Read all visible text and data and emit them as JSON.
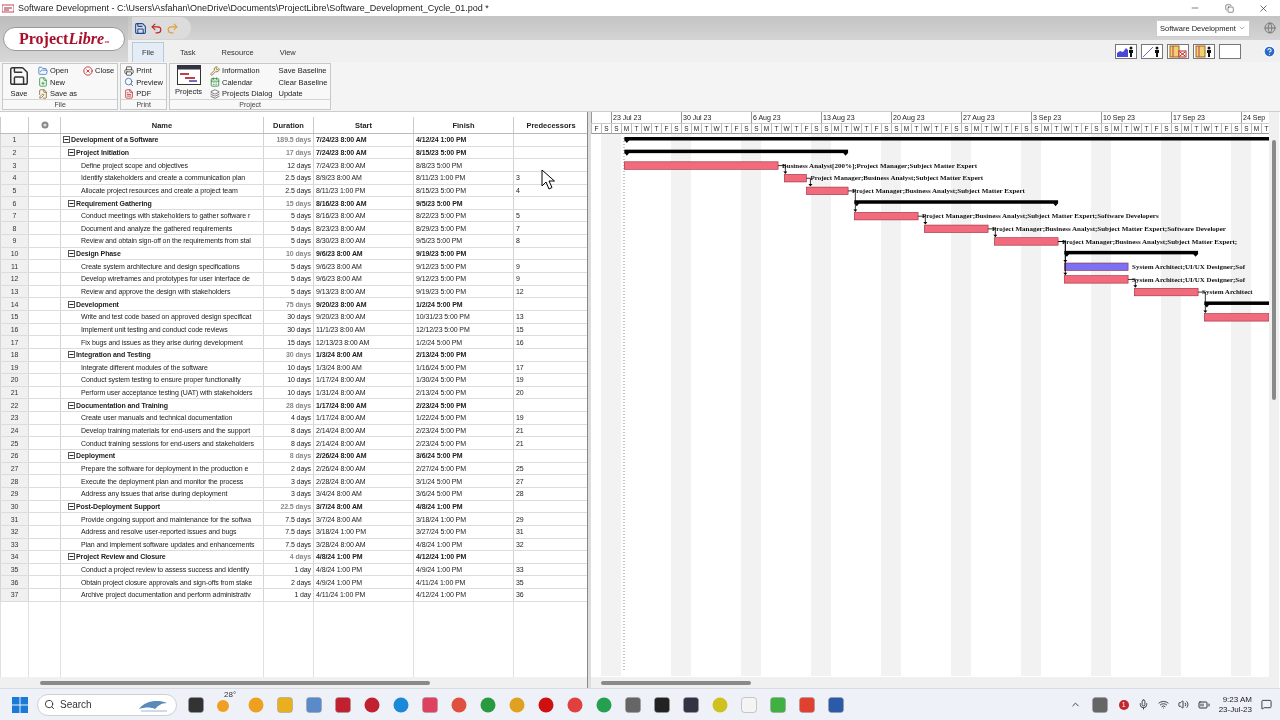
{
  "window": {
    "title": "Software Development  - C:\\Users\\Asfahan\\OneDrive\\Documents\\ProjectLibre\\Software_Development_Cycle_01.pod *"
  },
  "logo": {
    "text": "Project",
    "suffix": "Libre",
    "trademark": "™"
  },
  "tabs": [
    {
      "label": "File",
      "selected": true
    },
    {
      "label": "Task",
      "selected": false
    },
    {
      "label": "Resource",
      "selected": false
    },
    {
      "label": "View",
      "selected": false
    }
  ],
  "project_switcher": {
    "value": "Software Development"
  },
  "ribbon": {
    "groups": [
      {
        "title": "File",
        "items": [
          {
            "label": "Save",
            "kind": "large"
          },
          {
            "label": "Open",
            "kind": "small"
          },
          {
            "label": "New",
            "kind": "small"
          },
          {
            "label": "Save as",
            "kind": "small"
          },
          {
            "label": "Close",
            "kind": "small"
          }
        ]
      },
      {
        "title": "Print",
        "items": [
          {
            "label": "Print",
            "kind": "small"
          },
          {
            "label": "Preview",
            "kind": "small"
          },
          {
            "label": "PDF",
            "kind": "small"
          }
        ]
      },
      {
        "title": "Project",
        "items": [
          {
            "label": "Projects",
            "kind": "large"
          },
          {
            "label": "Information",
            "kind": "small"
          },
          {
            "label": "Calendar",
            "kind": "small"
          },
          {
            "label": "Projects Dialog",
            "kind": "small"
          },
          {
            "label": "Save Baseline",
            "kind": "text"
          },
          {
            "label": "Clear Baseline",
            "kind": "text"
          },
          {
            "label": "Update",
            "kind": "text"
          }
        ]
      }
    ]
  },
  "table": {
    "columns": [
      "Name",
      "Duration",
      "Start",
      "Finish",
      "Predecessors"
    ],
    "rows": [
      {
        "id": "1",
        "kind": "summary",
        "expanded": true,
        "name": "Development of a Software",
        "duration": "189.5 days",
        "start": "7/24/23 8:00 AM",
        "finish": "4/12/24 1:00 PM",
        "children": [
          {
            "id": "2",
            "kind": "summary",
            "expanded": true,
            "name": "Project Initiation",
            "duration": "17 days",
            "start": "7/24/23 8:00 AM",
            "finish": "8/15/23 5:00 PM",
            "children": [
              {
                "id": "3",
                "kind": "task",
                "name": "Define project scope and objectives",
                "duration": "12 days",
                "start": "7/24/23 8:00 AM",
                "finish": "8/8/23 5:00 PM",
                "color": "#f26b7c",
                "resources": "Business Analyst[200%];Project Manager;Subject Matter Expert"
              },
              {
                "id": "4",
                "kind": "task",
                "name": "Identify stakeholders and create a communication plan",
                "duration": "2.5 days",
                "start": "8/9/23 8:00 AM",
                "finish": "8/11/23 1:00 PM",
                "predecessors": "3",
                "color": "#f26b7c",
                "resources": "Project Manager;Business Analyst;Subject Matter Expert"
              },
              {
                "id": "5",
                "kind": "task",
                "name": "Allocate project resources and create a project team",
                "duration": "2.5 days",
                "start": "8/11/23 1:00 PM",
                "finish": "8/15/23 5:00 PM",
                "predecessors": "4",
                "color": "#f26b7c",
                "resources": "Project Manager;Business Analyst;Subject Matter Expert"
              }
            ]
          },
          {
            "id": "6",
            "kind": "summary",
            "expanded": true,
            "name": "Requirement Gathering",
            "duration": "15 days",
            "start": "8/16/23 8:00 AM",
            "finish": "9/5/23 5:00 PM",
            "children": [
              {
                "id": "7",
                "kind": "task",
                "name": "Conduct meetings with stakeholders to gather software r",
                "duration": "5 days",
                "start": "8/16/23 8:00 AM",
                "finish": "8/22/23 5:00 PM",
                "predecessors": "5",
                "color": "#f26b7c",
                "resources": "Project Manager;Business Analyst;Subject Matter Expert;Software Developers"
              },
              {
                "id": "8",
                "kind": "task",
                "name": "Document and analyze the gathered requirements",
                "duration": "5 days",
                "start": "8/23/23 8:00 AM",
                "finish": "8/29/23 5:00 PM",
                "predecessors": "7",
                "color": "#f26b7c",
                "resources": "Project Manager;Business Analyst;Subject Matter Expert;Software Developer"
              },
              {
                "id": "9",
                "kind": "task",
                "name": "Review and obtain sign-off on the requirements from stal",
                "duration": "5 days",
                "start": "8/30/23 8:00 AM",
                "finish": "9/5/23 5:00 PM",
                "predecessors": "8",
                "color": "#f26b7c",
                "resources": "Project Manager;Business Analyst;Subject Matter Expert;"
              }
            ]
          },
          {
            "id": "10",
            "kind": "summary",
            "expanded": true,
            "name": "Design Phase",
            "duration": "10 days",
            "start": "9/6/23 8:00 AM",
            "finish": "9/19/23 5:00 PM",
            "children": [
              {
                "id": "11",
                "kind": "task",
                "name": "Create system architecture and design specifications",
                "duration": "5 days",
                "start": "9/6/23 8:00 AM",
                "finish": "9/12/23 5:00 PM",
                "predecessors": "9",
                "color": "#7a72f2",
                "resources": "System Architect;UI/UX Designer;Sof"
              },
              {
                "id": "12",
                "kind": "task",
                "name": "Develop wireframes and prototypes for user interface de",
                "duration": "5 days",
                "start": "9/6/23 8:00 AM",
                "finish": "9/12/23 5:00 PM",
                "predecessors": "9",
                "color": "#f26b7c",
                "resources": "System Architect;UI/UX Designer;Sof"
              },
              {
                "id": "13",
                "kind": "task",
                "name": "Review and approve the design with stakeholders",
                "duration": "5 days",
                "start": "9/13/23 8:00 AM",
                "finish": "9/19/23 5:00 PM",
                "predecessors": "12",
                "color": "#f26b7c",
                "resources": "System Architect"
              }
            ]
          },
          {
            "id": "14",
            "kind": "summary",
            "expanded": true,
            "name": "Development",
            "duration": "75 days",
            "start": "9/20/23 8:00 AM",
            "finish": "1/2/24 5:00 PM",
            "children": [
              {
                "id": "15",
                "kind": "task",
                "name": "Write and test code based on approved design specificat",
                "duration": "30 days",
                "start": "9/20/23 8:00 AM",
                "finish": "10/31/23 5:00 PM",
                "predecessors": "13",
                "color": "#f26b7c"
              },
              {
                "id": "16",
                "kind": "task",
                "name": "Implement unit testing and conduct code reviews",
                "duration": "30 days",
                "start": "11/1/23 8:00 AM",
                "finish": "12/12/23 5:00 PM",
                "predecessors": "15"
              },
              {
                "id": "17",
                "kind": "task",
                "name": "Fix bugs and issues as they arise during development",
                "duration": "15 days",
                "start": "12/13/23 8:00 AM",
                "finish": "1/2/24 5:00 PM",
                "predecessors": "16"
              }
            ]
          },
          {
            "id": "18",
            "kind": "summary",
            "expanded": true,
            "name": "Integration and Testing",
            "duration": "30 days",
            "start": "1/3/24 8:00 AM",
            "finish": "2/13/24 5:00 PM",
            "children": [
              {
                "id": "19",
                "kind": "task",
                "name": "Integrate different modules of the software",
                "duration": "10 days",
                "start": "1/3/24 8:00 AM",
                "finish": "1/16/24 5:00 PM",
                "predecessors": "17"
              },
              {
                "id": "20",
                "kind": "task",
                "name": "Conduct system testing to ensure proper functionality",
                "duration": "10 days",
                "start": "1/17/24 8:00 AM",
                "finish": "1/30/24 5:00 PM",
                "predecessors": "19"
              },
              {
                "id": "21",
                "kind": "task",
                "name": "Perform user acceptance testing (UAT) with stakeholders",
                "duration": "10 days",
                "start": "1/31/24 8:00 AM",
                "finish": "2/13/24 5:00 PM",
                "predecessors": "20"
              }
            ]
          },
          {
            "id": "22",
            "kind": "summary",
            "expanded": true,
            "name": "Documentation and Training",
            "duration": "28 days",
            "start": "1/17/24 8:00 AM",
            "finish": "2/23/24 5:00 PM",
            "children": [
              {
                "id": "23",
                "kind": "task",
                "name": "Create user manuals and technical documentation",
                "duration": "4 days",
                "start": "1/17/24 8:00 AM",
                "finish": "1/22/24 5:00 PM",
                "predecessors": "19"
              },
              {
                "id": "24",
                "kind": "task",
                "name": "Develop training materials for end-users and the support",
                "duration": "8 days",
                "start": "2/14/24 8:00 AM",
                "finish": "2/23/24 5:00 PM",
                "predecessors": "21"
              },
              {
                "id": "25",
                "kind": "task",
                "name": "Conduct training sessions for end-users and stakeholders",
                "duration": "8 days",
                "start": "2/14/24 8:00 AM",
                "finish": "2/23/24 5:00 PM",
                "predecessors": "21"
              }
            ]
          },
          {
            "id": "26",
            "kind": "summary",
            "expanded": true,
            "name": "Deployment",
            "duration": "8 days",
            "start": "2/26/24 8:00 AM",
            "finish": "3/6/24 5:00 PM",
            "children": [
              {
                "id": "27",
                "kind": "task",
                "name": "Prepare the software for deployment in the production e",
                "duration": "2 days",
                "start": "2/26/24 8:00 AM",
                "finish": "2/27/24 5:00 PM",
                "predecessors": "25"
              },
              {
                "id": "28",
                "kind": "task",
                "name": "Execute the deployment plan and monitor the process",
                "duration": "3 days",
                "start": "2/28/24 8:00 AM",
                "finish": "3/1/24 5:00 PM",
                "predecessors": "27"
              },
              {
                "id": "29",
                "kind": "task",
                "name": "Address any issues that arise during deployment",
                "duration": "3 days",
                "start": "3/4/24 8:00 AM",
                "finish": "3/6/24 5:00 PM",
                "predecessors": "28"
              }
            ]
          },
          {
            "id": "30",
            "kind": "summary",
            "expanded": true,
            "name": "Post-Deployment Support",
            "duration": "22.5 days",
            "start": "3/7/24 8:00 AM",
            "finish": "4/8/24 1:00 PM",
            "children": [
              {
                "id": "31",
                "kind": "task",
                "name": "Provide ongoing support and maintenance for the softwa",
                "duration": "7.5 days",
                "start": "3/7/24 8:00 AM",
                "finish": "3/18/24 1:00 PM",
                "predecessors": "29"
              },
              {
                "id": "32",
                "kind": "task",
                "name": "Address and resolve user-reported issues and bugs",
                "duration": "7.5 days",
                "start": "3/18/24 1:00 PM",
                "finish": "3/27/24 5:00 PM",
                "predecessors": "31"
              },
              {
                "id": "33",
                "kind": "task",
                "name": "Plan and implement software updates and enhancements",
                "duration": "7.5 days",
                "start": "3/28/24 8:00 AM",
                "finish": "4/8/24 1:00 PM",
                "predecessors": "32"
              }
            ]
          },
          {
            "id": "34",
            "kind": "summary",
            "expanded": true,
            "name": "Project Review and Closure",
            "duration": "4 days",
            "start": "4/8/24 1:00 PM",
            "finish": "4/12/24 1:00 PM",
            "children": [
              {
                "id": "35",
                "kind": "task",
                "name": "Conduct a project review to assess success and identify",
                "duration": "1 day",
                "start": "4/8/24 1:00 PM",
                "finish": "4/9/24 1:00 PM",
                "predecessors": "33"
              },
              {
                "id": "36",
                "kind": "task",
                "name": "Obtain project closure approvals and sign-offs from stake",
                "duration": "2 days",
                "start": "4/9/24 1:00 PM",
                "finish": "4/11/24 1:00 PM",
                "predecessors": "35"
              },
              {
                "id": "37",
                "kind": "task",
                "name": "Archive project documentation and perform administrativ",
                "duration": "1 day",
                "start": "4/11/24 1:00 PM",
                "finish": "4/12/24 1:00 PM",
                "predecessors": "36"
              }
            ]
          }
        ]
      }
    ]
  },
  "gantt": {
    "weeks": [
      "23 Jul 23",
      "30 Jul 23",
      "6 Aug 23",
      "13 Aug 23",
      "20 Aug 23",
      "27 Aug 23",
      "3 Sep 23",
      "10 Sep 23",
      "17 Sep 23",
      "24 Sep"
    ],
    "days": [
      "F",
      "S",
      "S",
      "M",
      "T",
      "W",
      "T",
      "F",
      "S",
      "S",
      "M",
      "T",
      "W",
      "T",
      "F",
      "S",
      "S",
      "M",
      "T",
      "W",
      "T",
      "F",
      "S",
      "S",
      "M",
      "T",
      "W",
      "T",
      "F",
      "S",
      "S",
      "M",
      "T",
      "W",
      "T",
      "F",
      "S",
      "S",
      "M",
      "T",
      "W",
      "T",
      "F",
      "S",
      "S",
      "M",
      "T",
      "W",
      "T",
      "F",
      "S",
      "S",
      "M",
      "T",
      "W",
      "T",
      "F",
      "S",
      "S",
      "M",
      "T",
      "W",
      "T",
      "F",
      "S",
      "S",
      "M",
      "T"
    ]
  },
  "taskbar": {
    "search": {
      "placeholder": "Search"
    },
    "weather": "28°",
    "badge": "1",
    "time": "9:23 AM",
    "date": "23-Jul-23"
  }
}
